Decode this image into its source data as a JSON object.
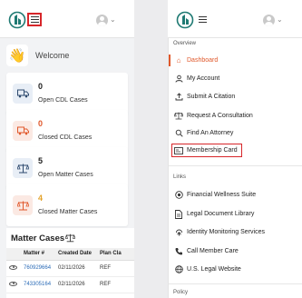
{
  "colors": {
    "accent": "#e0582b",
    "highlight": "#d7262a",
    "link": "#2a6bb7",
    "brand_teal": "#1f7a73"
  },
  "welcome": {
    "icon": "waving-hand-icon",
    "text": "Welcome"
  },
  "cards": [
    {
      "icon": "truck-icon",
      "count": "0",
      "label": "Open CDL Cases"
    },
    {
      "icon": "truck-icon",
      "count": "0",
      "label": "Closed CDL Cases"
    },
    {
      "icon": "scale-icon",
      "count": "5",
      "label": "Open Matter Cases"
    },
    {
      "icon": "scale-icon",
      "count": "4",
      "label": "Closed Matter Cases"
    }
  ],
  "matter_cases": {
    "title": "Matter Cases",
    "columns": [
      "",
      "Matter #",
      "Created Date",
      "Plan Cla"
    ],
    "rows": [
      {
        "matter": "760929664",
        "date": "02/11/2026",
        "plan": "REF"
      },
      {
        "matter": "743305164",
        "date": "02/11/2026",
        "plan": "REF"
      }
    ]
  },
  "drawer": {
    "overview_heading": "Overview",
    "overview_items": [
      {
        "label": "Dashboard",
        "icon": "home-icon",
        "active": true
      },
      {
        "label": "My Account",
        "icon": "user-icon"
      },
      {
        "label": "Submit A Citation",
        "icon": "upload-icon"
      },
      {
        "label": "Request A Consultation",
        "icon": "scale-icon"
      },
      {
        "label": "Find An Attorney",
        "icon": "search-icon"
      },
      {
        "label": "Membership Card",
        "icon": "id-card-icon",
        "highlighted": true
      }
    ],
    "links_heading": "Links",
    "link_items": [
      {
        "label": "Financial Wellness Suite",
        "icon": "target-icon"
      },
      {
        "label": "Legal Document Library",
        "icon": "document-icon"
      },
      {
        "label": "Identity Monitoring Services",
        "icon": "fingerprint-icon"
      },
      {
        "label": "Call Member Care",
        "icon": "phone-icon"
      },
      {
        "label": "U.S. Legal Website",
        "icon": "globe-icon"
      }
    ],
    "policy_heading": "Policy"
  }
}
